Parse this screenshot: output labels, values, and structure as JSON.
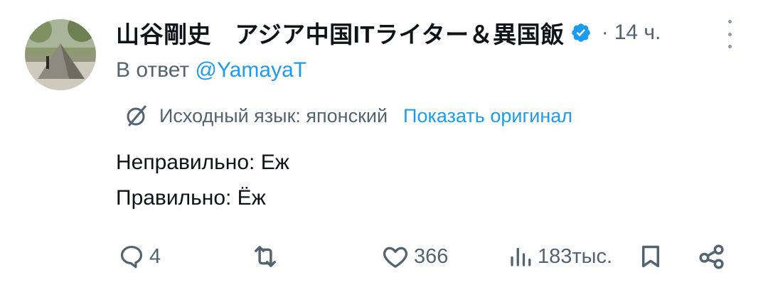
{
  "tweet": {
    "author_name": "山谷剛史　アジア中国ITライター＆異国飯",
    "verified_icon": "verified-badge-icon",
    "separator": "·",
    "time": "14 ч.",
    "reply_prefix": "В ответ",
    "reply_handle": "@YamayaT",
    "translation": {
      "source_language": "Исходный язык: японский",
      "show_original": "Показать оригинал"
    },
    "body": {
      "line1": "Неправильно: Еж",
      "line2": "Правильно: Ёж"
    },
    "actions": {
      "reply_count": "4",
      "retweet_count": "",
      "like_count": "366",
      "views_count": "183тыс."
    }
  },
  "colors": {
    "text": "#0f1419",
    "secondary": "#536471",
    "accent": "#1d9bf0"
  }
}
